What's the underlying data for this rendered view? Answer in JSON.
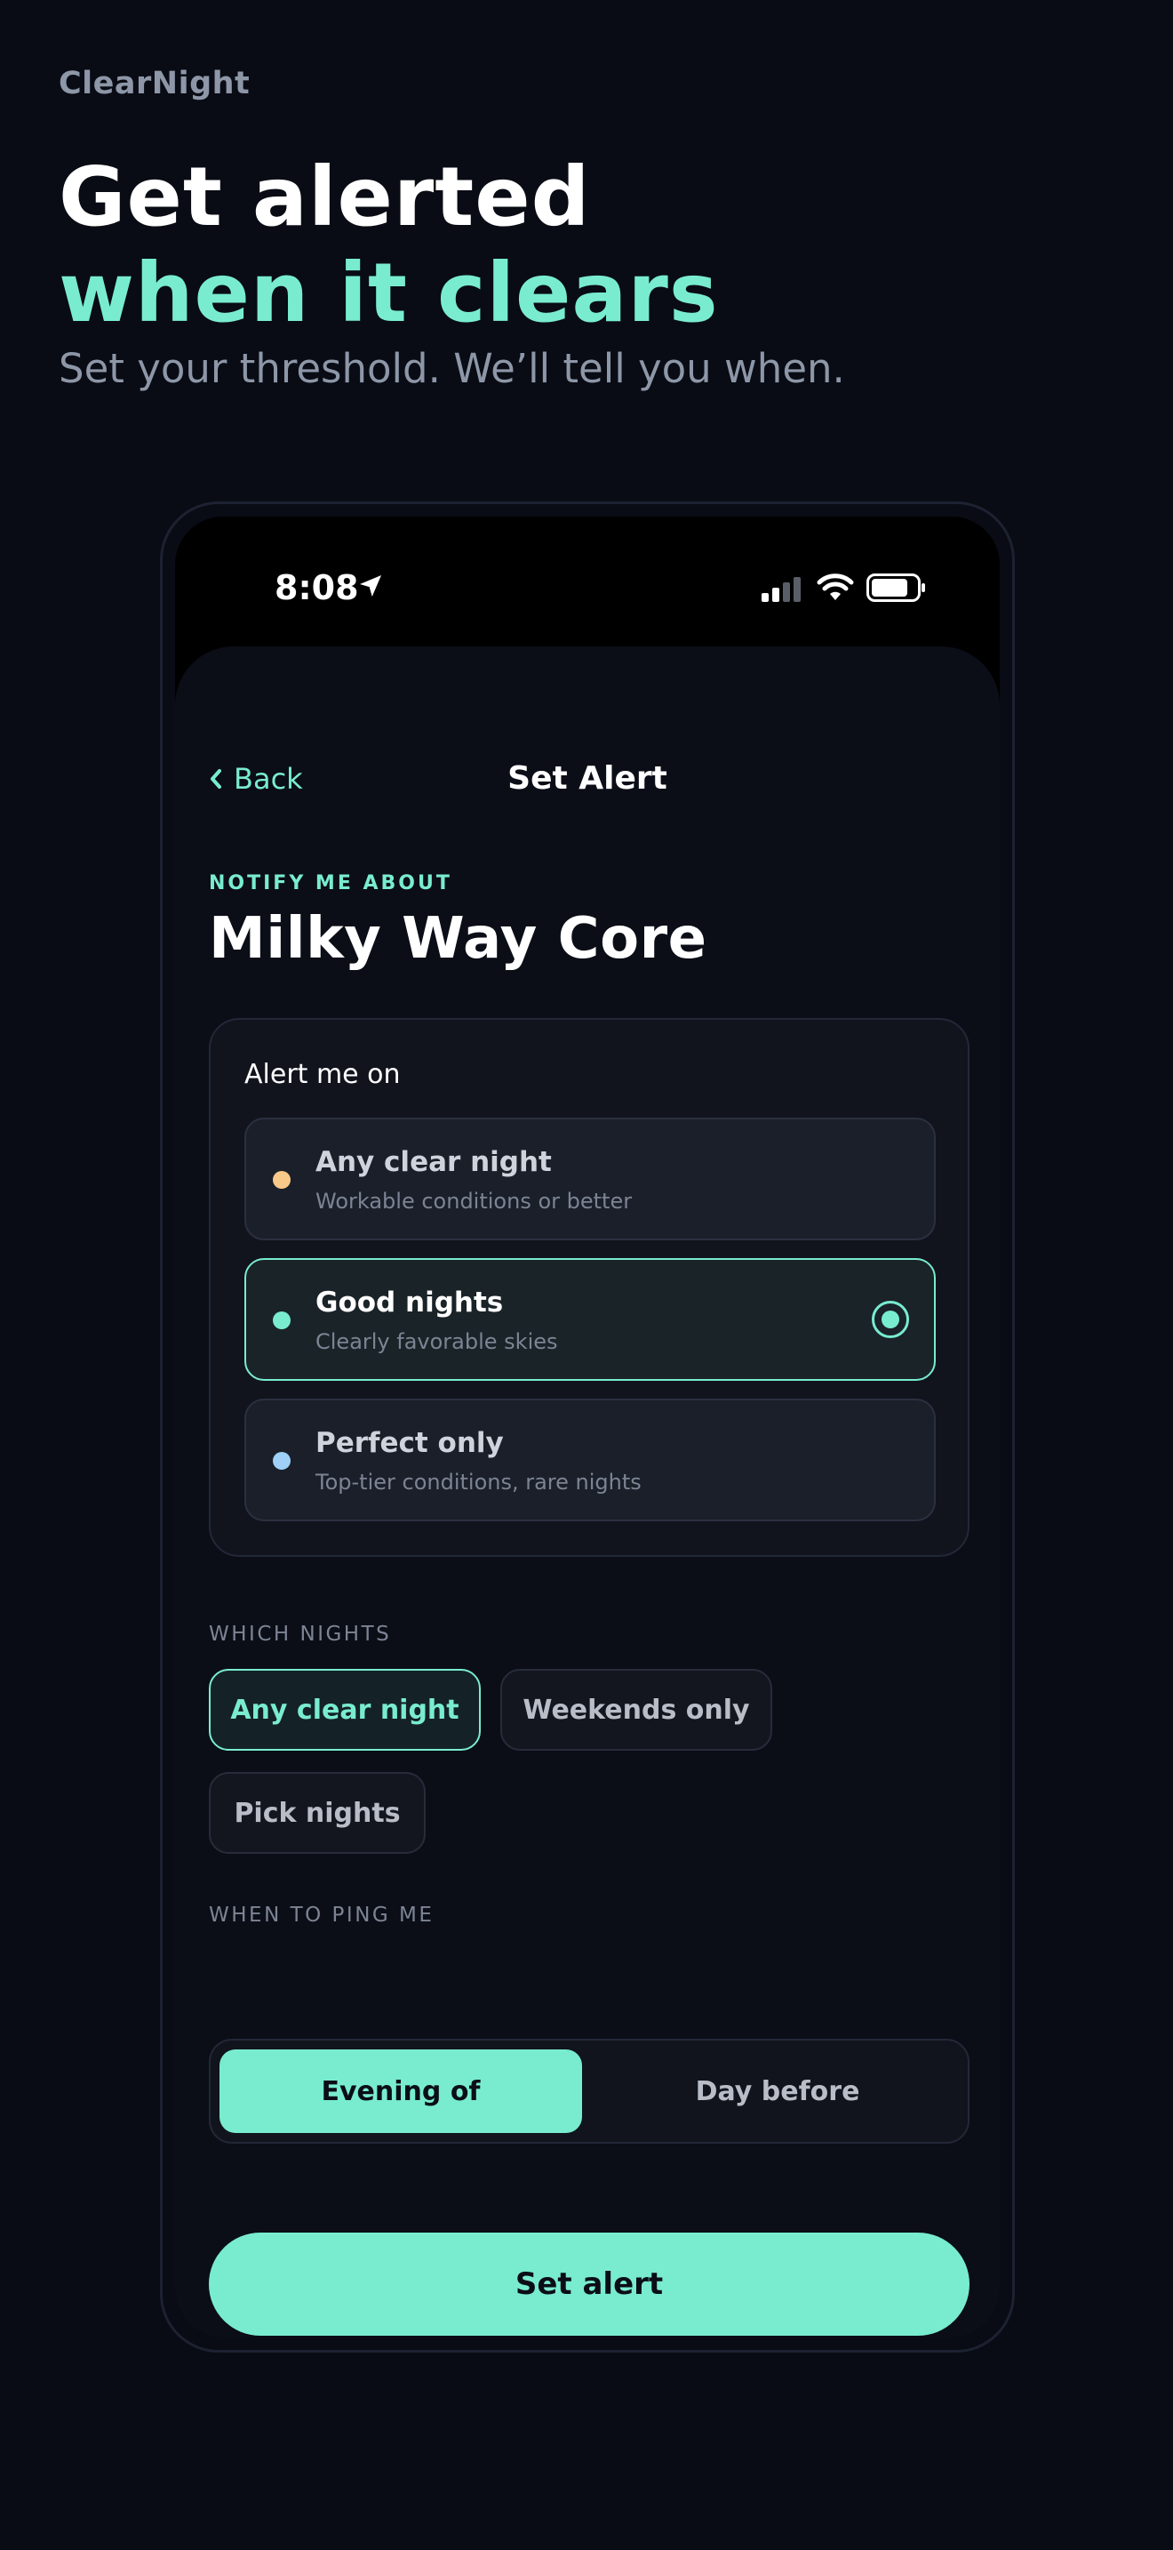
{
  "brand": "ClearNight",
  "headline": {
    "line1": "Get alerted",
    "line2": "when it clears"
  },
  "subhead": "Set your threshold. We’ll tell you when.",
  "status_bar": {
    "time": "8:08"
  },
  "nav": {
    "back_label": "Back",
    "title": "Set Alert"
  },
  "target": {
    "eyebrow": "NOTIFY ME ABOUT",
    "name": "Milky Way Core"
  },
  "alert_card": {
    "title": "Alert me on",
    "options": [
      {
        "title": "Any clear night",
        "subtitle": "Workable conditions or better",
        "dot_color": "#f9c98a",
        "selected": false
      },
      {
        "title": "Good nights",
        "subtitle": "Clearly favorable skies",
        "dot_color": "#79ecd0",
        "selected": true
      },
      {
        "title": "Perfect only",
        "subtitle": "Top-tier conditions, rare nights",
        "dot_color": "#9fd0f7",
        "selected": false
      }
    ]
  },
  "which_nights": {
    "label": "WHICH NIGHTS",
    "chips": [
      {
        "label": "Any clear night",
        "active": true
      },
      {
        "label": "Weekends only",
        "active": false
      },
      {
        "label": "Pick nights",
        "active": false
      }
    ]
  },
  "when_to_ping": {
    "label": "WHEN TO PING ME",
    "options": [
      {
        "label": "Evening of",
        "active": true
      },
      {
        "label": "Day before",
        "active": false
      }
    ]
  },
  "cta_label": "Set alert",
  "colors": {
    "accent": "#79ecd0",
    "background": "#090c14",
    "muted": "#8d97a8"
  }
}
